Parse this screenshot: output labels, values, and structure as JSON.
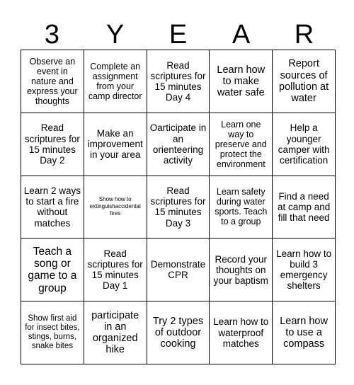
{
  "card": {
    "header_letters": [
      "3",
      "Y",
      "E",
      "A",
      "R"
    ],
    "grid": {
      "columns": 5,
      "rows": 5,
      "cells": [
        {
          "text": "Observe an event in nature and express your thoughts",
          "size": "sm"
        },
        {
          "text": "Complete an assignment from your camp director",
          "size": "sm"
        },
        {
          "text": "Read scriptures for 15 minutes Day 4",
          "size": "md"
        },
        {
          "text": "Learn how to make water safe",
          "size": "lg"
        },
        {
          "text": "Report sources of pollution at water",
          "size": "lg"
        },
        {
          "text": "Read scriptures for 15 minutes Day 2",
          "size": "md"
        },
        {
          "text": "Make an improvement in your area",
          "size": "md"
        },
        {
          "text": "Oarticipate in an orienteering activity",
          "size": "md"
        },
        {
          "text": "Learn one way to preserve and protect the environment",
          "size": "sm"
        },
        {
          "text": "Help a younger camper with certification",
          "size": "md"
        },
        {
          "text": "Learn 2 ways to start a fire without matches",
          "size": "md"
        },
        {
          "text": "Show how to extinguishaccidental fires",
          "size": "xxs"
        },
        {
          "text": "Read scriptures for 15 minutes Day 3",
          "size": "md"
        },
        {
          "text": "Learn safety during water sports. Teach to a group",
          "size": "sm"
        },
        {
          "text": "Find a need at camp and fill that need",
          "size": "md"
        },
        {
          "text": "Teach a song or game to a group",
          "size": "xl"
        },
        {
          "text": "Read scriptures for 15 minutes Day 1",
          "size": "md"
        },
        {
          "text": "Demonstrate CPR",
          "size": "md"
        },
        {
          "text": "Record your thoughts on your baptism",
          "size": "md"
        },
        {
          "text": "Learn how to build 3 emergency shelters",
          "size": "md"
        },
        {
          "text": "Show first aid for insect bites, stings, burns, snake bites",
          "size": "xs"
        },
        {
          "text": "participate in an organized hike",
          "size": "lg"
        },
        {
          "text": "Try 2 types of outdoor cooking",
          "size": "lg"
        },
        {
          "text": "Learn how to waterproof matches",
          "size": "md"
        },
        {
          "text": "Learn how to use a compass",
          "size": "lg"
        }
      ]
    },
    "colors": {
      "background": "#ffffff",
      "text": "#000000",
      "border": "#000000"
    }
  }
}
